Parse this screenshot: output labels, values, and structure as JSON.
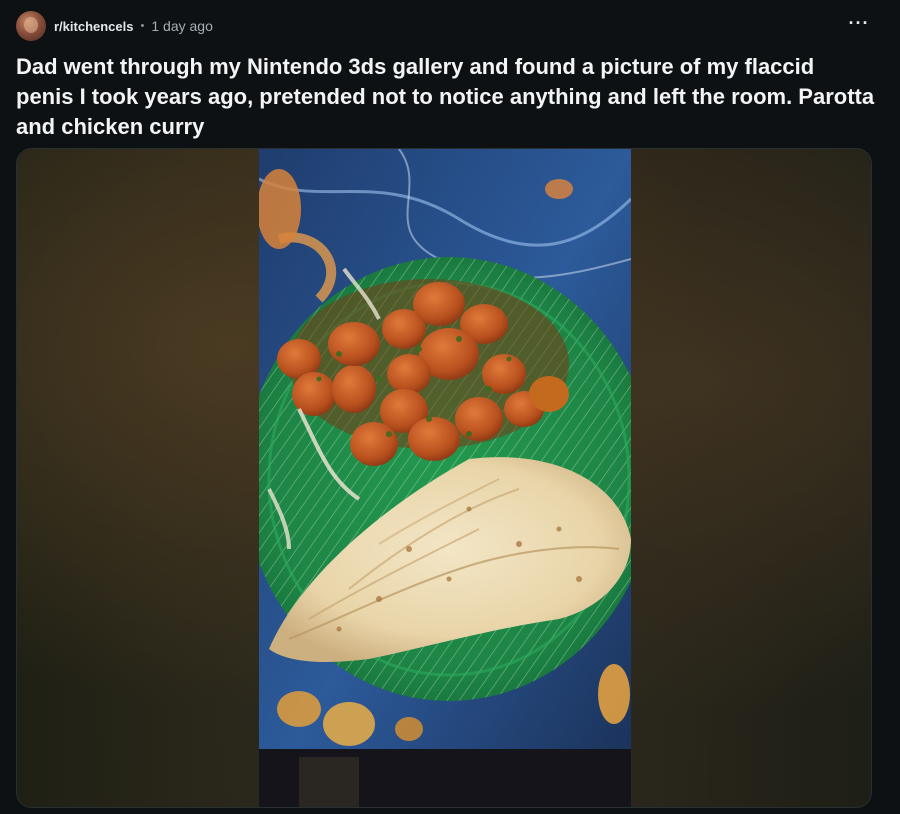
{
  "post": {
    "subreddit": "r/kitchencels",
    "separator": "•",
    "time": "1 day ago",
    "more_label": "···",
    "title": "Dad went through my Nintendo 3ds gallery and found a picture of my flaccid penis I took years ago, pretended not to notice anything and left the room. Parotta and chicken curry"
  },
  "icons": {
    "avatar": "subreddit-avatar",
    "more": "more-options-icon"
  },
  "colors": {
    "background": "#0e1113",
    "title_text": "#f2f4f5",
    "meta_text": "#a4b0b6",
    "plate": "#1f8a4a"
  }
}
